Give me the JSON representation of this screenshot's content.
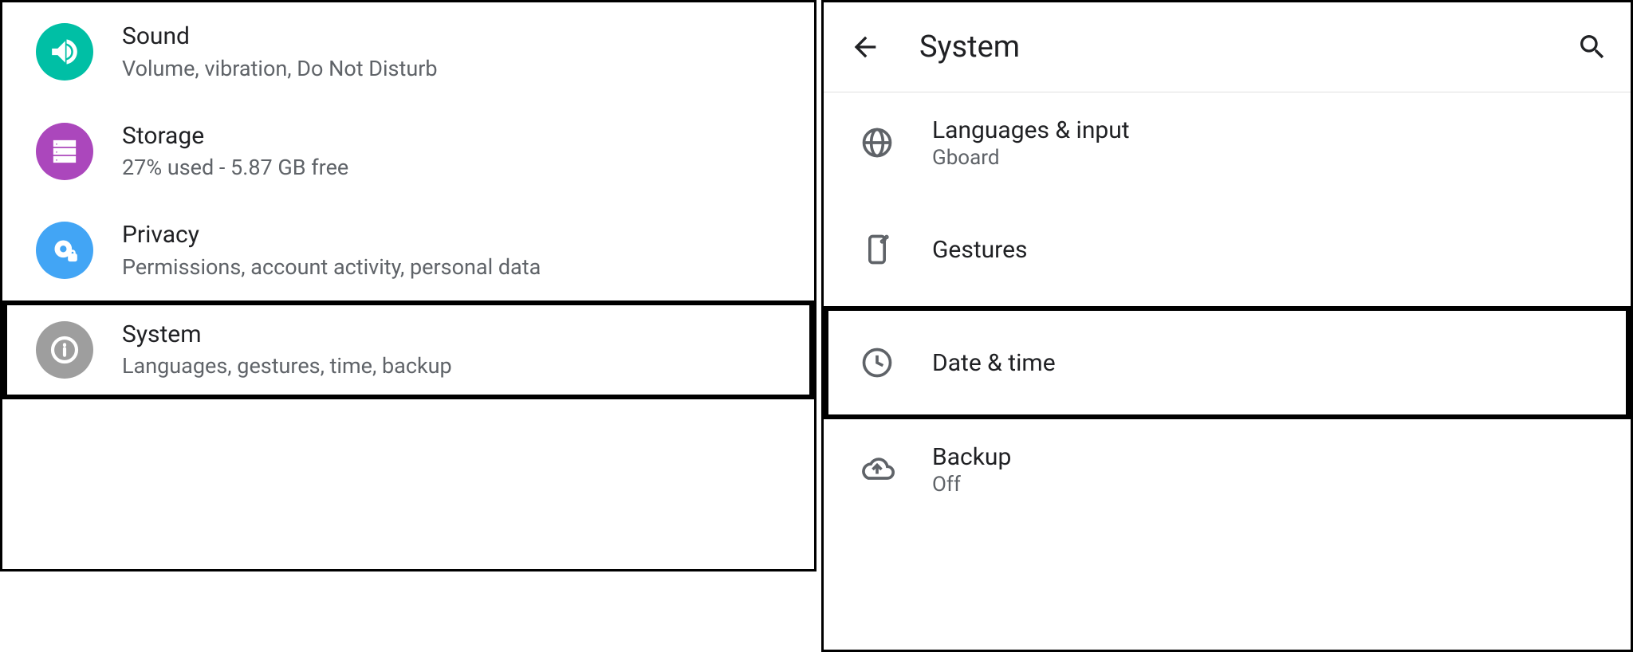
{
  "left": {
    "items": [
      {
        "title": "Sound",
        "subtitle": "Volume, vibration, Do Not Disturb"
      },
      {
        "title": "Storage",
        "subtitle": "27% used - 5.87 GB free"
      },
      {
        "title": "Privacy",
        "subtitle": "Permissions, account activity, personal data"
      },
      {
        "title": "System",
        "subtitle": "Languages, gestures, time, backup"
      }
    ]
  },
  "right": {
    "header_title": "System",
    "items": [
      {
        "title": "Languages & input",
        "subtitle": "Gboard"
      },
      {
        "title": "Gestures",
        "subtitle": ""
      },
      {
        "title": "Date & time",
        "subtitle": ""
      },
      {
        "title": "Backup",
        "subtitle": "Off"
      }
    ]
  }
}
